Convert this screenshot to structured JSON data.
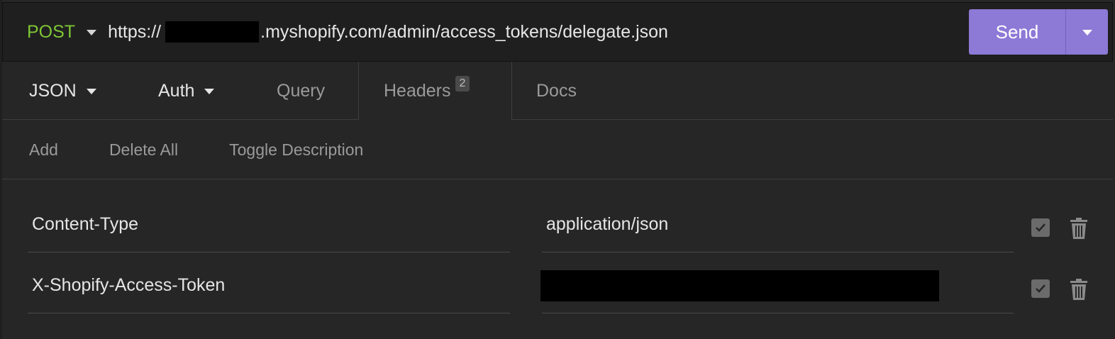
{
  "request": {
    "method": "POST",
    "url_prefix": "https://",
    "url_suffix": ".myshopify.com/admin/access_tokens/delegate.json",
    "send_label": "Send"
  },
  "tabs": {
    "body_type": "JSON",
    "auth": "Auth",
    "query": "Query",
    "headers": "Headers",
    "headers_count": "2",
    "docs": "Docs"
  },
  "actions": {
    "add": "Add",
    "delete_all": "Delete All",
    "toggle_description": "Toggle Description"
  },
  "headers": [
    {
      "name": "Content-Type",
      "value": "application/json",
      "enabled": true
    },
    {
      "name": "X-Shopify-Access-Token",
      "value": "",
      "enabled": true
    }
  ],
  "colors": {
    "method": "#7ec636",
    "send_button": "#8d79d6",
    "background": "#262626"
  },
  "icons": [
    "chevron-down-icon",
    "checkbox-check-icon",
    "trash-icon"
  ]
}
